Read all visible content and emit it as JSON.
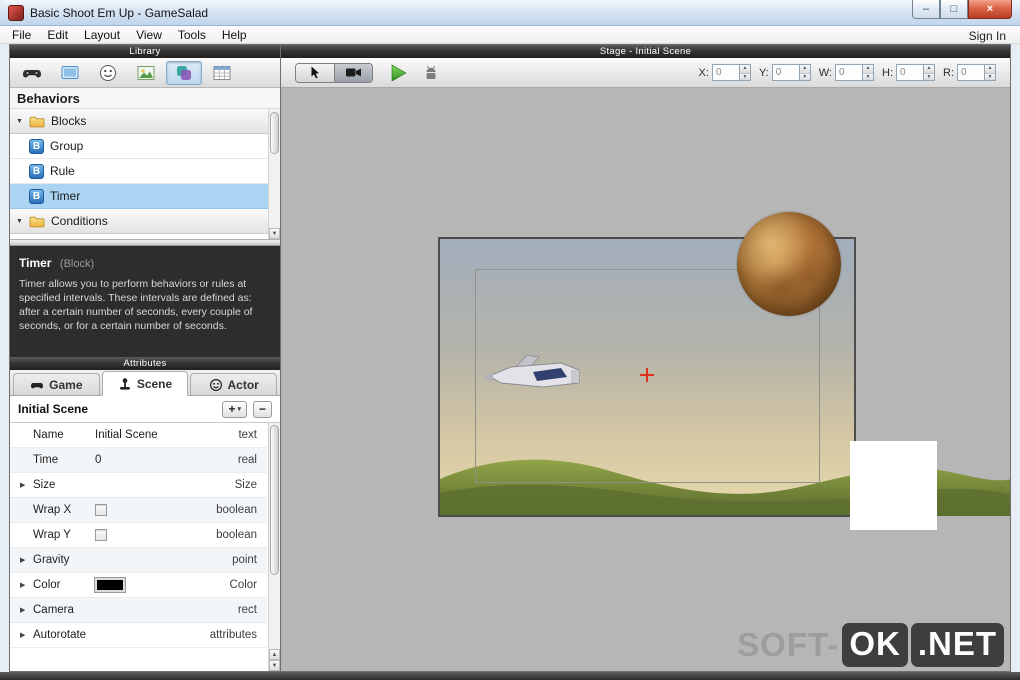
{
  "ui": {
    "disclosure_expanded": "▼",
    "disclosure_collapsed": "▶",
    "add": "+",
    "add_caret": "▾",
    "remove": "−",
    "scroll_up": "▲",
    "scroll_down": "▼",
    "spin_up": "▲",
    "spin_down": "▼"
  },
  "window": {
    "title": "Basic Shoot Em Up - GameSalad",
    "menu": [
      "File",
      "Edit",
      "Layout",
      "View",
      "Tools",
      "Help"
    ],
    "sign_in": "Sign In",
    "controls": {
      "minimize": "–",
      "maximize": "□",
      "close": "×"
    }
  },
  "library": {
    "header": "Library",
    "toolbar_tabs": [
      "game",
      "scenes",
      "actors",
      "images",
      "behaviors",
      "tables"
    ],
    "selected_tab": "behaviors",
    "section_title": "Behaviors",
    "tree": [
      {
        "label": "Blocks",
        "kind": "folder"
      },
      {
        "label": "Group",
        "kind": "behavior",
        "badge": "B"
      },
      {
        "label": "Rule",
        "kind": "behavior",
        "badge": "B"
      },
      {
        "label": "Timer",
        "kind": "behavior",
        "badge": "B",
        "selected": true
      },
      {
        "label": "Conditions",
        "kind": "folder"
      }
    ],
    "description": {
      "title": "Timer",
      "kind": "(Block)",
      "body": "Timer allows you to perform behaviors or rules at specified intervals. These intervals are defined as: after a certain number of seconds, every couple of seconds, or for a certain number of seconds."
    }
  },
  "attributes": {
    "header": "Attributes",
    "tabs": [
      {
        "label": "Game"
      },
      {
        "label": "Scene"
      },
      {
        "label": "Actor"
      }
    ],
    "active_tab": "Scene",
    "scene_name": "Initial Scene",
    "rows": [
      {
        "name": "Name",
        "value": "Initial Scene",
        "type": "text"
      },
      {
        "name": "Time",
        "value": "0",
        "type": "real"
      },
      {
        "name": "Size",
        "value": "",
        "type": "Size"
      },
      {
        "name": "Wrap X",
        "value": "",
        "type": "boolean"
      },
      {
        "name": "Wrap Y",
        "value": "",
        "type": "boolean"
      },
      {
        "name": "Gravity",
        "value": "",
        "type": "point"
      },
      {
        "name": "Color",
        "value": "",
        "type": "Color"
      },
      {
        "name": "Camera",
        "value": "",
        "type": "rect"
      },
      {
        "name": "Autorotate",
        "value": "",
        "type": "attributes"
      }
    ]
  },
  "stage": {
    "header": "Stage - Initial Scene",
    "coords": [
      {
        "label": "X:",
        "value": "0"
      },
      {
        "label": "Y:",
        "value": "0"
      },
      {
        "label": "W:",
        "value": "0"
      },
      {
        "label": "H:",
        "value": "0"
      },
      {
        "label": "R:",
        "value": "0"
      }
    ]
  },
  "watermark": {
    "soft": "SOFT-",
    "ok": "OK",
    "net": ".NET"
  },
  "colors": {
    "selection": "#abd3f2",
    "play_green": "#3faa34",
    "close_red": "#d9523e",
    "sky_top": "#a2aebc",
    "sky_bottom": "#e8dbae",
    "hills_green": "#7d9140",
    "planet_brown": "#b07838"
  }
}
